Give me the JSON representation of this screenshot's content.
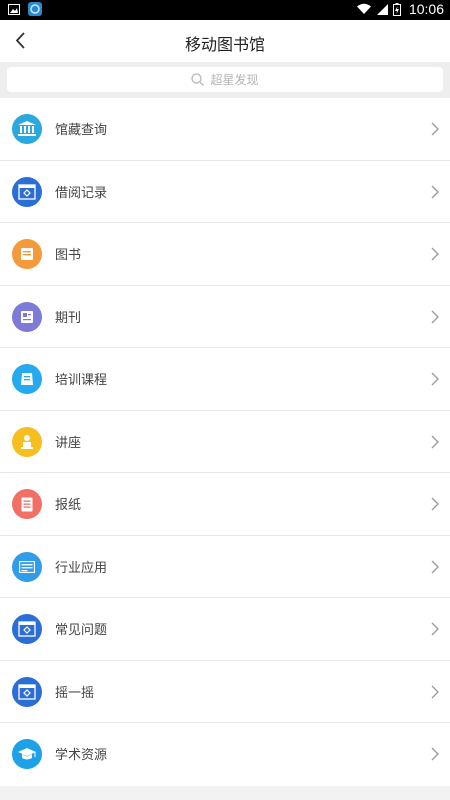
{
  "status_bar": {
    "time": "10:06"
  },
  "header": {
    "title": "移动图书馆"
  },
  "search": {
    "placeholder": "超星发现"
  },
  "menu": {
    "items": [
      {
        "label": "馆藏查询",
        "icon": "library-building-icon",
        "color": "#2aa8e0"
      },
      {
        "label": "借阅记录",
        "icon": "borrow-record-icon",
        "color": "#2b6fd6"
      },
      {
        "label": "图书",
        "icon": "book-icon",
        "color": "#f59a3a"
      },
      {
        "label": "期刊",
        "icon": "journal-icon",
        "color": "#7e7ad8"
      },
      {
        "label": "培训课程",
        "icon": "course-icon",
        "color": "#25aaf0"
      },
      {
        "label": "讲座",
        "icon": "lecture-icon",
        "color": "#f7be1f"
      },
      {
        "label": "报纸",
        "icon": "newspaper-icon",
        "color": "#f26f63"
      },
      {
        "label": "行业应用",
        "icon": "industry-app-icon",
        "color": "#2f9de8"
      },
      {
        "label": "常见问题",
        "icon": "faq-icon",
        "color": "#2b6fd6"
      },
      {
        "label": "摇一摇",
        "icon": "shake-icon",
        "color": "#2b6fd6"
      },
      {
        "label": "学术资源",
        "icon": "academic-cap-icon",
        "color": "#1da2e8"
      }
    ]
  }
}
